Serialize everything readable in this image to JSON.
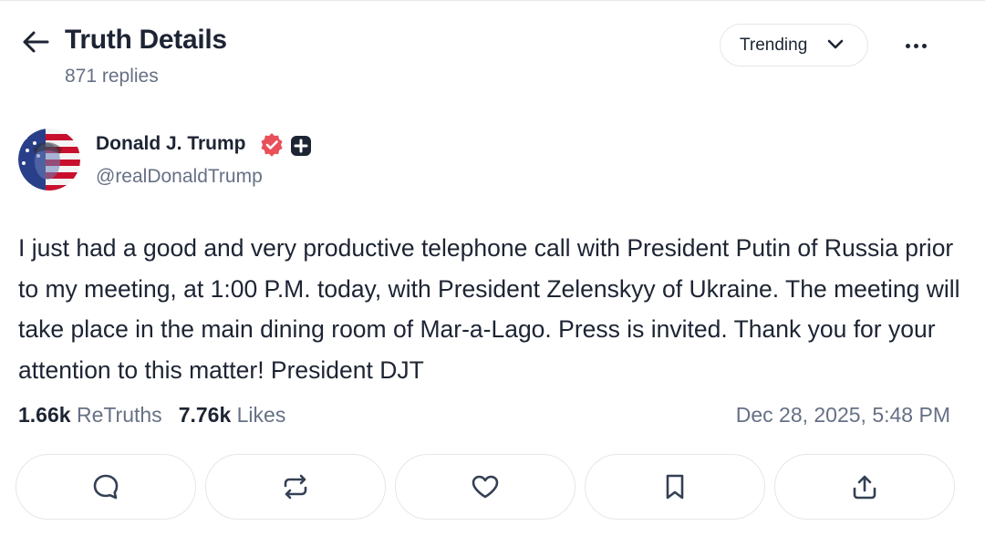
{
  "header": {
    "title": "Truth Details",
    "replies": "871 replies",
    "sort_label": "Trending"
  },
  "author": {
    "name": "Donald J. Trump",
    "handle": "@realDonaldTrump"
  },
  "post": {
    "text": "I just had a good and very productive telephone call with President Putin of Russia prior to my meeting, at 1:00 P.M. today, with President Zelenskyy of Ukraine. The meeting will take place in the main dining room of Mar-a-Lago. Press is invited. Thank you for your attention to this matter! President DJT"
  },
  "stats": {
    "retruths_count": "1.66k",
    "retruths_label": "ReTruths",
    "likes_count": "7.76k",
    "likes_label": "Likes",
    "timestamp": "Dec 28, 2025, 5:48 PM"
  },
  "actions": [
    {
      "icon": "reply-icon"
    },
    {
      "icon": "retruth-icon"
    },
    {
      "icon": "heart-icon"
    },
    {
      "icon": "bookmark-icon"
    },
    {
      "icon": "share-icon"
    }
  ],
  "colors": {
    "text_primary": "#1d2433",
    "text_secondary": "#667085",
    "verified_badge": "#e8505b",
    "border": "#e4e7ec"
  }
}
